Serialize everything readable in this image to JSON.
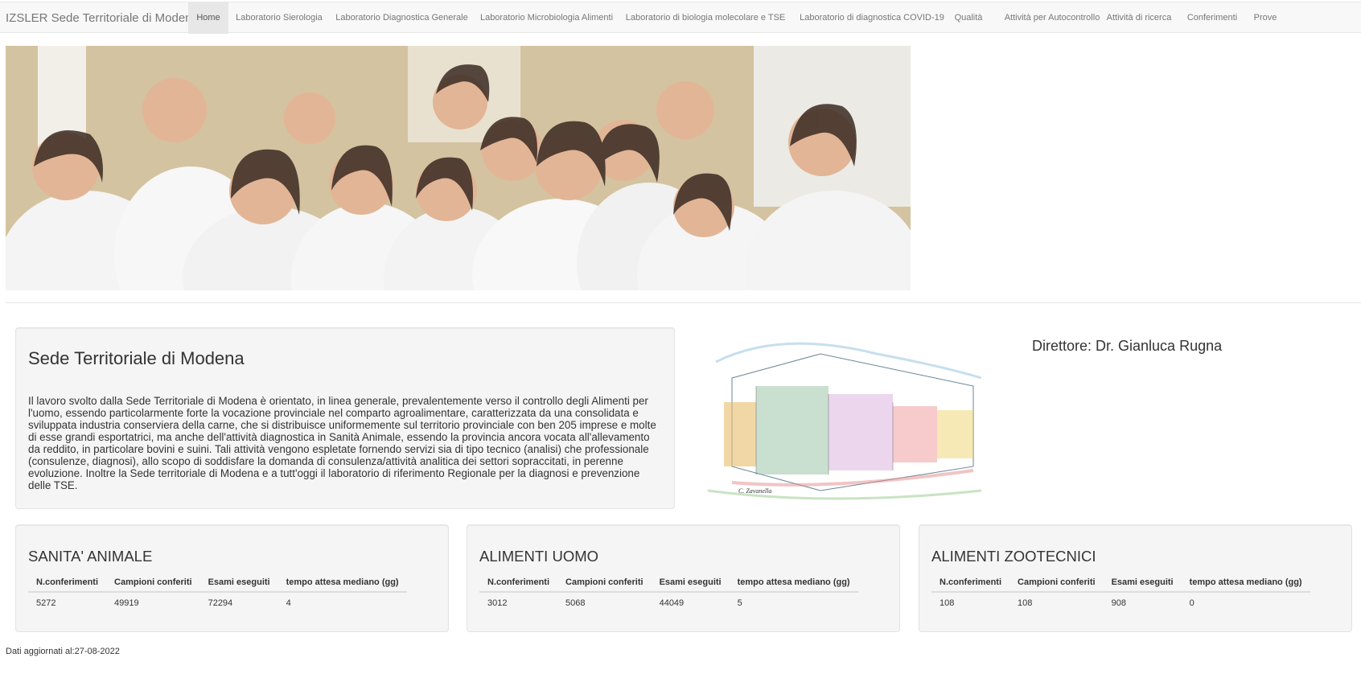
{
  "navbar": {
    "brand": "IZSLER Sede Territoriale di Modena",
    "items": [
      {
        "label": "Home"
      },
      {
        "label": "Laboratorio Sierologia"
      },
      {
        "label": "Laboratorio Diagnostica Generale"
      },
      {
        "label": "Laboratorio Microbiologia Alimenti"
      },
      {
        "label": "Laboratorio di biologia molecolare e TSE"
      },
      {
        "label": "Laboratorio di diagnostica COVID-19"
      },
      {
        "label": "Qualità"
      },
      {
        "label": "Attività per Autocontrollo"
      },
      {
        "label": "Attività di ricerca"
      },
      {
        "label": "Conferimenti"
      },
      {
        "label": "Prove"
      }
    ],
    "active_index": 0
  },
  "about": {
    "title": "Sede Territoriale di Modena",
    "text": "Il lavoro svolto dalla Sede Territoriale di Modena è orientato, in linea generale, prevalentemente verso il controllo degli Alimenti per l'uomo, essendo particolarmente forte la vocazione provinciale nel comparto agroalimentare, caratterizzata da una consolidata e sviluppata industria conserviera della carne, che si distribuisce uniformemente sul territorio provinciale con ben 205 imprese e molte di esse grandi esportatrici, ma anche dell'attività diagnostica in Sanità Animale, essendo la provincia ancora vocata all'allevamento da reddito, in particolare bovini e suini. Tali attività vengono espletate fornendo servizi sia di tipo tecnico (analisi) che professionale (consulenze, diagnosi), allo scopo di soddisfare la domanda di consulenza/attività analitica dei settori sopraccitati, in perenne evoluzione. Inoltre la Sede territoriale di Modena e a tutt'oggi il laboratorio di riferimento Regionale per la diagnosi e prevenzione delle TSE."
  },
  "sketch_signature": "C. Zavanella",
  "director": "Direttore: Dr. Gianluca Rugna",
  "table_headers": [
    "N.conferimenti",
    "Campioni conferiti",
    "Esami eseguiti",
    "tempo attesa mediano (gg)"
  ],
  "stats": [
    {
      "title": "SANITA' ANIMALE",
      "values": [
        "5272",
        "49919",
        "72294",
        "4"
      ]
    },
    {
      "title": "ALIMENTI UOMO",
      "values": [
        "3012",
        "5068",
        "44049",
        "5"
      ]
    },
    {
      "title": "ALIMENTI ZOOTECNICI",
      "values": [
        "108",
        "108",
        "908",
        "0"
      ]
    }
  ],
  "updated": "Dati aggiornati al:27-08-2022",
  "colors": {
    "navbar_bg": "#f8f8f8",
    "nav_text": "#777777",
    "well_bg": "#f5f5f5"
  }
}
